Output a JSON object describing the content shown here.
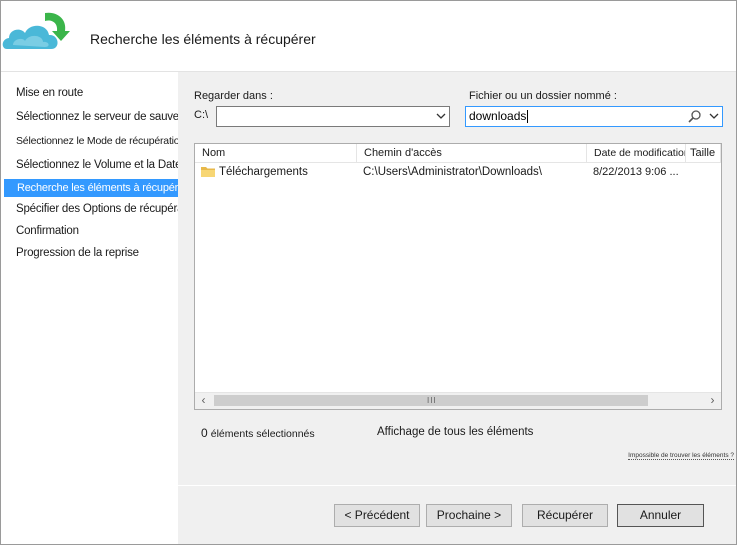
{
  "header": {
    "title": "Recherche les éléments à récupérer"
  },
  "sidebar": {
    "items": [
      {
        "label": "Mise en route",
        "active": false
      },
      {
        "label": "Sélectionnez le serveur de sauvegarde",
        "active": false
      },
      {
        "label": "Sélectionnez le Mode de récupération",
        "active": false
      },
      {
        "label": "Sélectionnez le Volume et la Date",
        "active": false
      },
      {
        "label": "Recherche les éléments à récupérer",
        "active": true
      },
      {
        "label": "Spécifier des Options de récupération",
        "active": false
      },
      {
        "label": "Confirmation",
        "active": false
      },
      {
        "label": "Progression de la reprise",
        "active": false
      }
    ]
  },
  "search": {
    "look_in_label": "Regarder dans :",
    "look_in_prefix": "C:\\",
    "look_in_value": "",
    "name_label": "Fichier ou un dossier nommé :",
    "name_value": "downloads"
  },
  "results": {
    "columns": [
      "Nom",
      "Chemin d'accès",
      "Date de modification",
      "Taille"
    ],
    "rows": [
      {
        "name": "Téléchargements",
        "path": "C:\\Users\\Administrator\\Downloads\\",
        "modified": "8/22/2013 9:06 ...",
        "size": ""
      }
    ],
    "scroll_grip": "III"
  },
  "status": {
    "count": "0",
    "count_label": "éléments sélectionnés",
    "display_mode": "Affichage de tous les éléments",
    "not_found_link": "Impossible de trouver les éléments ?"
  },
  "buttons": {
    "previous": "< Précédent",
    "next": "Prochaine >",
    "recover": "Récupérer",
    "cancel": "Annuler"
  },
  "colors": {
    "selection": "#3399ff",
    "panel": "#f0f0f0",
    "logo_cloud": "#4ab8d8",
    "logo_arrow": "#3bb54a"
  }
}
